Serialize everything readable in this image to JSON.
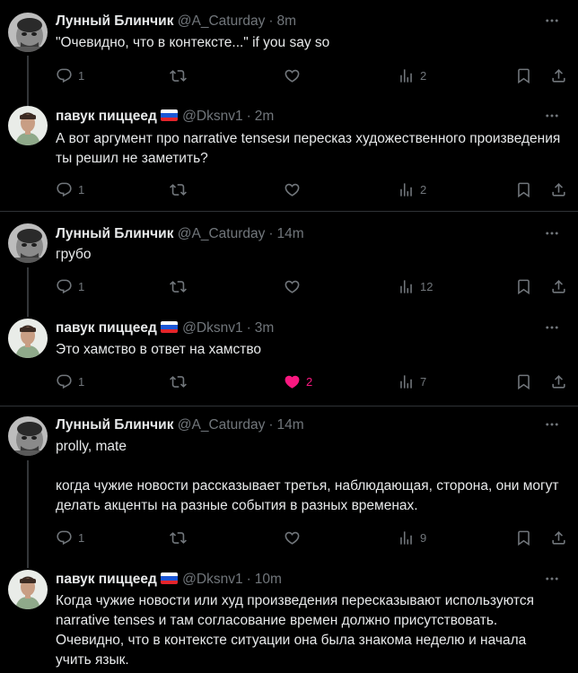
{
  "tweets": [
    {
      "name": "Лунный Блинчик",
      "handle": "@A_Caturday",
      "dot": "·",
      "time": "8m",
      "flag": false,
      "avatar": "avatar-caturday",
      "text": "\"Очевидно, что в контексте...\"  if you say so",
      "replies": "1",
      "reposts": "",
      "likes": "",
      "views": "2",
      "liked": false
    },
    {
      "name": "павук пиццеед",
      "handle": "@Dksnv1",
      "dot": "·",
      "time": "2m",
      "flag": true,
      "avatar": "avatar-dksnv1",
      "text": "А вот аргумент про narrative tensesи пересказ художественного произведения ты решил не заметить?",
      "replies": "1",
      "reposts": "",
      "likes": "",
      "views": "2",
      "liked": false
    },
    {
      "name": "Лунный Блинчик",
      "handle": "@A_Caturday",
      "dot": "·",
      "time": "14m",
      "flag": false,
      "avatar": "avatar-caturday",
      "text": "грубо",
      "replies": "1",
      "reposts": "",
      "likes": "",
      "views": "12",
      "liked": false
    },
    {
      "name": "павук пиццеед",
      "handle": "@Dksnv1",
      "dot": "·",
      "time": "3m",
      "flag": true,
      "avatar": "avatar-dksnv1",
      "text": "Это хамство в ответ на хамство",
      "replies": "1",
      "reposts": "",
      "likes": "2",
      "views": "7",
      "liked": true
    },
    {
      "name": "Лунный Блинчик",
      "handle": "@A_Caturday",
      "dot": "·",
      "time": "14m",
      "flag": false,
      "avatar": "avatar-caturday",
      "text": "prolly, mate",
      "text2": "когда чужие новости рассказывает третья, наблюдающая, сторона, они могут делать акценты на разные события в разных временах.",
      "replies": "1",
      "reposts": "",
      "likes": "",
      "views": "9",
      "liked": false
    },
    {
      "name": "павук пиццеед",
      "handle": "@Dksnv1",
      "dot": "·",
      "time": "10m",
      "flag": true,
      "avatar": "avatar-dksnv1",
      "text": "Когда чужие новости или худ произведения пересказывают используются narrative tenses и там согласование времен должно присутствовать. Очевидно, что в контексте ситуации она была знакома неделю и начала учить язык."
    }
  ],
  "colors": {
    "bg": "#000000",
    "text": "#e7e9ea",
    "muted": "#71767b",
    "like": "#f91880",
    "border": "#2f3336"
  }
}
